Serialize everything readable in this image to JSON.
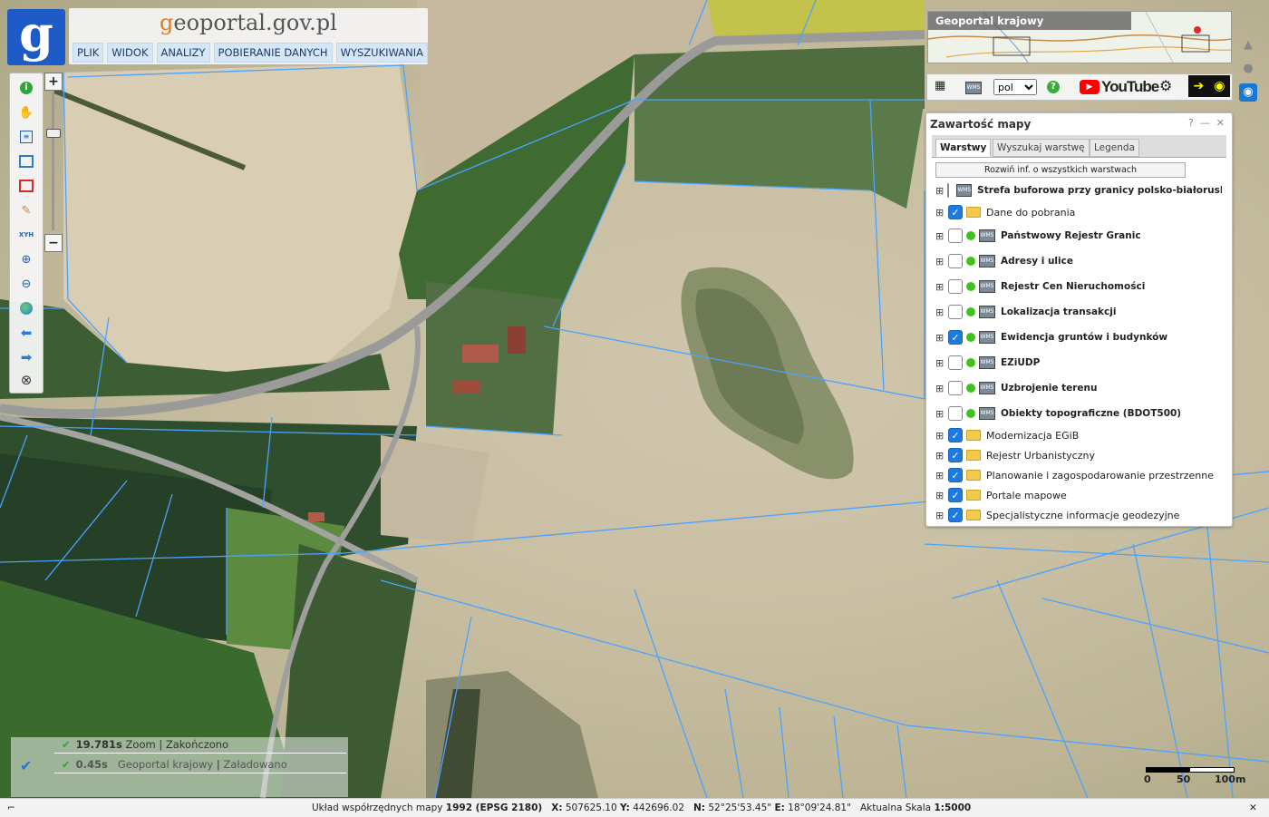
{
  "header": {
    "logo_letter": "g",
    "site_title_prefix": "g",
    "site_title_rest": "eoportal.gov.pl",
    "menu": [
      "PLIK",
      "WIDOK",
      "ANALIZY",
      "POBIERANIE DANYCH",
      "WYSZUKIWANIA"
    ]
  },
  "toolbar": {
    "tools": [
      "info-icon",
      "pan-hand-icon",
      "list-icon",
      "select-icon",
      "select-red-icon",
      "pencil-icon",
      "xyh-icon",
      "zoom-in-icon",
      "zoom-out-icon",
      "globe-icon",
      "back-arrow-icon",
      "forward-arrow-icon",
      "stop-icon"
    ],
    "xyh_label": "XYH",
    "zoom_in": "+",
    "zoom_out": "−"
  },
  "overview": {
    "title": "Geoportal krajowy"
  },
  "tools_row": {
    "language": "pol",
    "language_options": [
      "pol"
    ],
    "youtube": "YouTube"
  },
  "layers_panel": {
    "title": "Zawartość mapy",
    "help": "?",
    "minimize": "—",
    "close": "✕",
    "tabs": [
      "Warstwy",
      "Wyszukaj warstwę",
      "Legenda"
    ],
    "expand_all": "Rozwiń inf. o wszystkich warstwach",
    "layers": [
      {
        "name": "Strefa buforowa przy granicy polsko-białoruskiej",
        "checked": false,
        "type": "wms"
      },
      {
        "name": "Dane do pobrania",
        "checked": true,
        "type": "folder"
      },
      {
        "name": "Państwowy Rejestr Granic",
        "checked": false,
        "type": "wms"
      },
      {
        "name": "Adresy i ulice",
        "checked": false,
        "type": "wms"
      },
      {
        "name": "Rejestr Cen Nieruchomości",
        "checked": false,
        "type": "wms"
      },
      {
        "name": "Lokalizacja transakcji",
        "checked": false,
        "type": "wms"
      },
      {
        "name": "Ewidencja gruntów i budynków",
        "checked": true,
        "type": "wms"
      },
      {
        "name": "EZiUDP",
        "checked": false,
        "type": "wms"
      },
      {
        "name": "Uzbrojenie terenu",
        "checked": false,
        "type": "wms"
      },
      {
        "name": "Obiekty topograficzne (BDOT500)",
        "checked": false,
        "type": "wms"
      },
      {
        "name": "Modernizacja EGiB",
        "checked": true,
        "type": "folder"
      },
      {
        "name": "Rejestr Urbanistyczny",
        "checked": true,
        "type": "folder"
      },
      {
        "name": "Planowanie i zagospodarowanie przestrzenne",
        "checked": true,
        "type": "folder"
      },
      {
        "name": "Portale mapowe",
        "checked": true,
        "type": "folder"
      },
      {
        "name": "Specjalistyczne informacje geodezyjne",
        "checked": true,
        "type": "folder"
      }
    ]
  },
  "status": {
    "rows": [
      {
        "time": "19.781s",
        "task": "Zoom",
        "state": "Zakończono"
      },
      {
        "time": "0.45s",
        "task": "Geoportal krajowy",
        "state": "Załadowano"
      }
    ]
  },
  "scale": {
    "labels": [
      "0",
      "50",
      "100m"
    ]
  },
  "bottom": {
    "crs_label": "Układ współrzędnych mapy",
    "crs_value": "1992 (EPSG 2180)",
    "x_label": "X:",
    "x_value": "507625.10",
    "y_label": "Y:",
    "y_value": "442696.02",
    "n_label": "N:",
    "n_value": "52°25'53.45\"",
    "e_label": "E:",
    "e_value": "18°09'24.81\"",
    "scale_label": "Aktualna Skala",
    "scale_value": "1:5000"
  },
  "colors": {
    "accent": "#1e5bc6",
    "parcel_line": "#4aa3ff",
    "check": "#1f7ae0"
  }
}
